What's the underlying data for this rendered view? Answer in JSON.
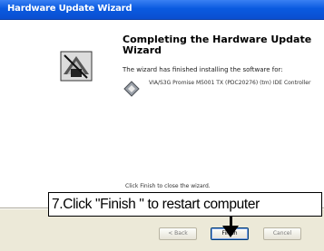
{
  "window": {
    "title": "Hardware Update Wizard"
  },
  "wizard": {
    "heading": "Completing the Hardware Update Wizard",
    "message": "The wizard has finished installing the software for:",
    "device_name": "VIA/S3G Promise M5001 TX (PDC20276) (tm) IDE Controller",
    "finish_hint": "Click Finish to close the wizard.",
    "logo_icon": "hardware-wizard-icon",
    "device_icon": "device-icon"
  },
  "buttons": {
    "back_label": "< Back",
    "finish_label": "Finish",
    "cancel_label": "Cancel"
  },
  "callout": {
    "text": "7.Click \"Finish \" to restart computer"
  },
  "colors": {
    "titlebar": "#0a5ae0",
    "dialog_bg": "#ece9d8",
    "callout_border": "#000000"
  }
}
